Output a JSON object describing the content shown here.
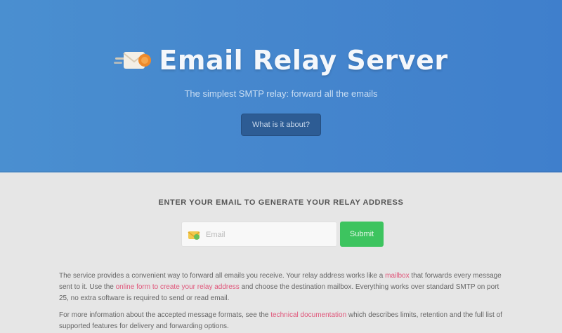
{
  "hero": {
    "title": "Email Relay Server",
    "subtitle": "The simplest SMTP relay: forward all the emails",
    "cta_label": "What is it about?",
    "logo_icon": "envelope-rocket-icon"
  },
  "signup": {
    "heading": "Enter your email to generate your relay address",
    "email_placeholder": "Email",
    "email_value": "",
    "submit_label": "Submit",
    "mail_icon": "envelope-icon"
  },
  "description": {
    "p1_before": "The service provides a convenient way to forward all emails you receive. Your relay address works like a",
    "p1_link1": "mailbox",
    "p1_middle": "that forwards every message sent to it. Use the",
    "p1_link2": "online form to create your relay address",
    "p1_after": "and choose the destination mailbox. Everything works over standard SMTP on port 25, no extra software is required to send or read email.",
    "p2_before": "For more information about the accepted message formats, see the",
    "p2_link": "technical documentation",
    "p2_after": "which describes limits, retention and the full list of supported features for delivery and forwarding options."
  },
  "colors": {
    "hero_bg": "#4586cd",
    "submit_green": "#3dc45f",
    "link_pink": "#e0567a",
    "cta_bg": "#2d5c94"
  }
}
